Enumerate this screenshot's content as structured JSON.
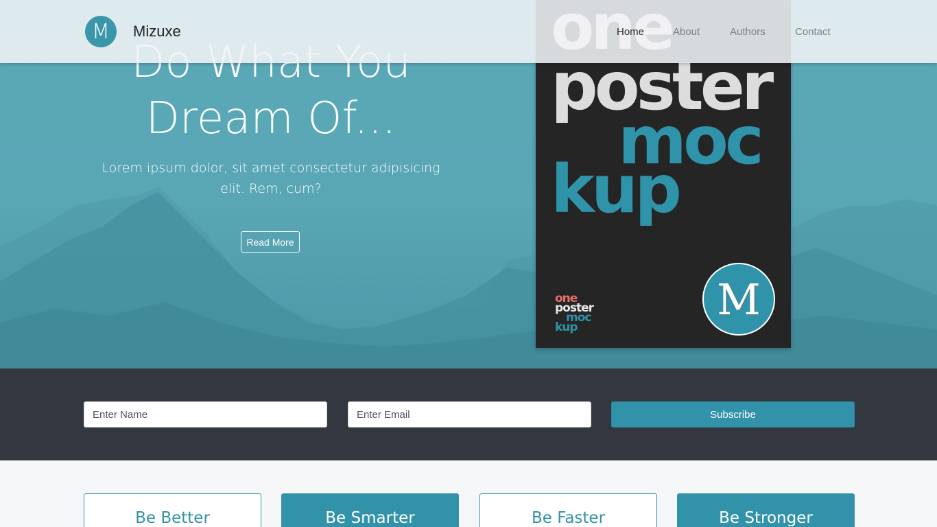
{
  "brand": {
    "logo_letter": "M",
    "name": "Mizuxe"
  },
  "nav": {
    "items": [
      {
        "label": "Home",
        "active": true
      },
      {
        "label": "About",
        "active": false
      },
      {
        "label": "Authors",
        "active": false
      },
      {
        "label": "Contact",
        "active": false
      }
    ]
  },
  "hero": {
    "title_line1": "Do What You",
    "title_line2": "Dream Of...",
    "subtitle": "Lorem ipsum dolor, sit amet consectetur adipisicing elit. Rem, cum?",
    "button_label": "Read More"
  },
  "poster": {
    "word1": "one",
    "word2": "poster",
    "word3": "moc",
    "word4": "kup",
    "logo_letter": "M"
  },
  "subscribe": {
    "name_placeholder": "Enter Name",
    "email_placeholder": "Enter Email",
    "button_label": "Subscribe"
  },
  "features": [
    {
      "label": "Be Better",
      "style": "outline"
    },
    {
      "label": "Be Smarter",
      "style": "filled"
    },
    {
      "label": "Be Faster",
      "style": "outline"
    },
    {
      "label": "Be Stronger",
      "style": "filled"
    }
  ],
  "colors": {
    "accent": "#3192a9",
    "hero_bg": "#5ba8b7",
    "dark_bar": "#333740"
  }
}
